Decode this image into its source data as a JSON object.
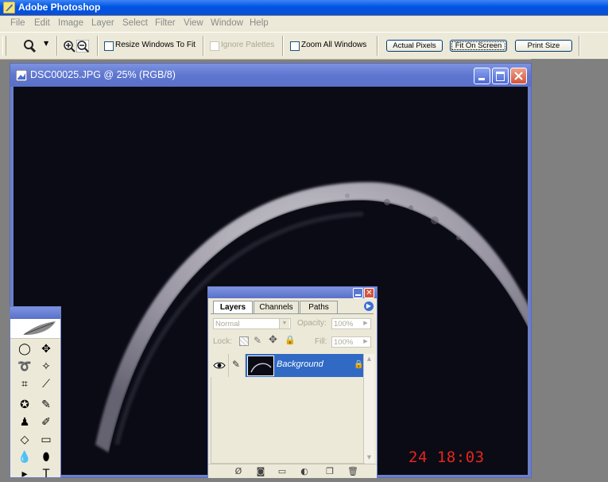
{
  "app": {
    "title": "Adobe Photoshop"
  },
  "menu": [
    "File",
    "Edit",
    "Image",
    "Layer",
    "Select",
    "Filter",
    "View",
    "Window",
    "Help"
  ],
  "options": {
    "resize_windows": "Resize Windows To Fit",
    "ignore_palettes": "Ignore Palettes",
    "zoom_all_windows": "Zoom All Windows",
    "actual_pixels": "Actual Pixels",
    "fit_on_screen": "Fit On Screen",
    "print_size": "Print Size"
  },
  "document": {
    "title": "DSC00025.JPG @ 25% (RGB/8)",
    "date_stamp": "24  18:03"
  },
  "layers_palette": {
    "tabs": [
      "Layers",
      "Channels",
      "Paths"
    ],
    "blend_mode": "Normal",
    "opacity_label": "Opacity:",
    "opacity_value": "100%",
    "lock_label": "Lock:",
    "fill_label": "Fill:",
    "fill_value": "100%",
    "layer_name": "Background"
  },
  "colors": {
    "titlebar": "#0054e3",
    "doc_titlebar": "#6b7ec9",
    "selection": "#316ac5",
    "date_stamp": "#e8241c"
  }
}
